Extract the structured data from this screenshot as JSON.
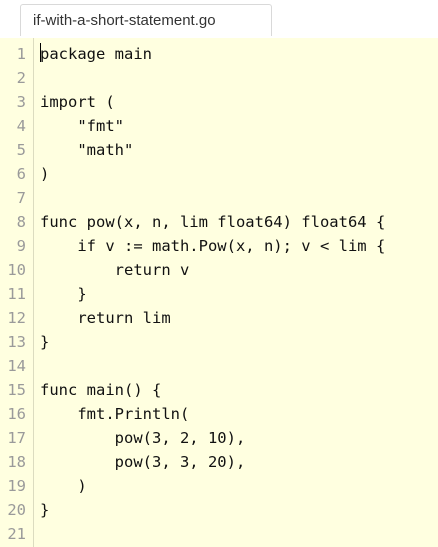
{
  "tab": {
    "filename": "if-with-a-short-statement.go"
  },
  "editor": {
    "background": "#ffffe0",
    "lines": [
      {
        "number": "1",
        "text": "package main"
      },
      {
        "number": "2",
        "text": ""
      },
      {
        "number": "3",
        "text": "import ("
      },
      {
        "number": "4",
        "text": "    \"fmt\""
      },
      {
        "number": "5",
        "text": "    \"math\""
      },
      {
        "number": "6",
        "text": ")"
      },
      {
        "number": "7",
        "text": ""
      },
      {
        "number": "8",
        "text": "func pow(x, n, lim float64) float64 {"
      },
      {
        "number": "9",
        "text": "    if v := math.Pow(x, n); v < lim {"
      },
      {
        "number": "10",
        "text": "        return v"
      },
      {
        "number": "11",
        "text": "    }"
      },
      {
        "number": "12",
        "text": "    return lim"
      },
      {
        "number": "13",
        "text": "}"
      },
      {
        "number": "14",
        "text": ""
      },
      {
        "number": "15",
        "text": "func main() {"
      },
      {
        "number": "16",
        "text": "    fmt.Println("
      },
      {
        "number": "17",
        "text": "        pow(3, 2, 10),"
      },
      {
        "number": "18",
        "text": "        pow(3, 3, 20),"
      },
      {
        "number": "19",
        "text": "    )"
      },
      {
        "number": "20",
        "text": "}"
      },
      {
        "number": "21",
        "text": ""
      }
    ]
  }
}
